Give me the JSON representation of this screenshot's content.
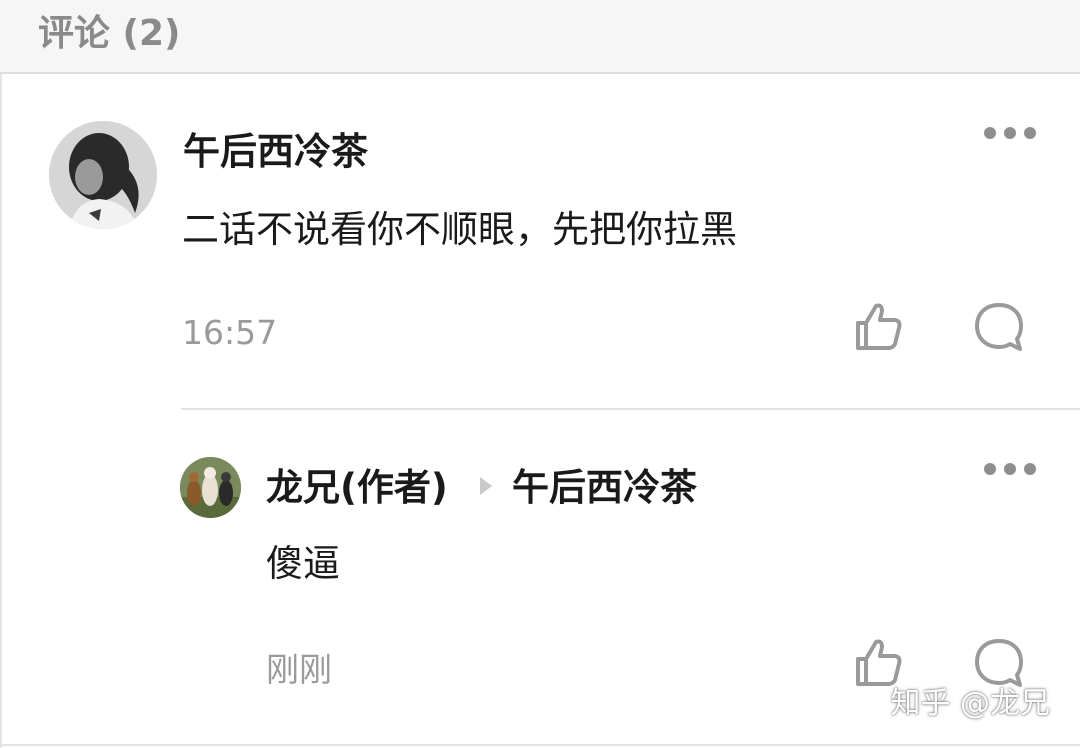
{
  "header": {
    "title": "评论 (2)"
  },
  "comments": [
    {
      "username": "午后西冷茶",
      "text": "二话不说看你不顺眼，先把你拉黑",
      "time": "16:57"
    }
  ],
  "replies": [
    {
      "username": "龙兄(作者)",
      "reply_to": "午后西冷茶",
      "text": "傻逼",
      "time": "刚刚"
    }
  ],
  "icons": {
    "more": "more-dots-icon",
    "like": "thumbs-up-icon",
    "reply": "speech-bubble-icon"
  },
  "colors": {
    "header_bg": "#f6f6f6",
    "header_text": "#8a8a8a",
    "username": "#1a1a1a",
    "meta": "#9a9a9a",
    "icon": "#9a9a9a"
  },
  "watermark": "知乎 @龙兄"
}
